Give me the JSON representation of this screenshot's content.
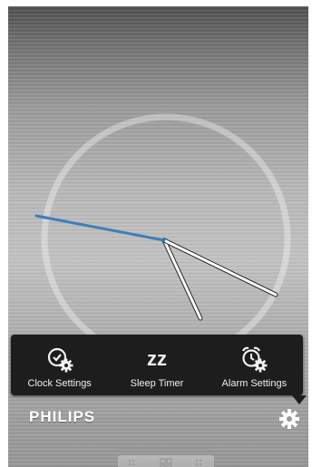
{
  "menu": {
    "items": [
      {
        "label": "Clock Settings",
        "icon": "clock-gear-icon"
      },
      {
        "label": "Sleep Timer",
        "icon": "sleep-zz-icon",
        "glyph": "zz"
      },
      {
        "label": "Alarm Settings",
        "icon": "alarm-gear-icon"
      }
    ]
  },
  "brand": {
    "name": "PHILIPS"
  },
  "settings": {
    "icon": "gear-icon"
  },
  "colors": {
    "minute_hand": "#3d7fb8",
    "menu_bg": "#1d1d1d"
  }
}
